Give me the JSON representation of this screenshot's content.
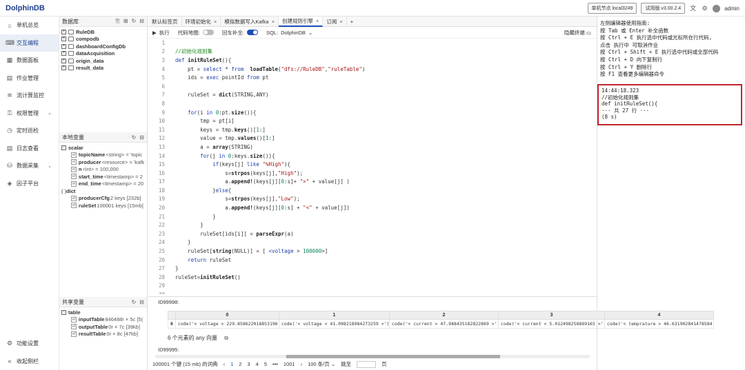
{
  "app": {
    "logo": "DolphinDB",
    "node_btn": "单机节点 local3249",
    "version_btn": "试用版 v3.00.2.4",
    "user": "admin"
  },
  "sidebar": {
    "items": [
      {
        "label": "单机总览",
        "icon": "home-icon"
      },
      {
        "label": "交互编程",
        "icon": "code-icon",
        "active": true
      },
      {
        "label": "数据面板",
        "icon": "dashboard-icon"
      },
      {
        "label": "作业管理",
        "icon": "job-icon"
      },
      {
        "label": "流计算监控",
        "icon": "stream-icon"
      },
      {
        "label": "权限管理",
        "icon": "lock-icon",
        "chevron": true
      },
      {
        "label": "定时巡检",
        "icon": "clock-icon"
      },
      {
        "label": "日志查看",
        "icon": "log-icon"
      },
      {
        "label": "数据采集",
        "icon": "collect-icon",
        "chevron": true
      },
      {
        "label": "因子平台",
        "icon": "factor-icon"
      }
    ],
    "settings": "功能设置",
    "collapse": "收起侧栏"
  },
  "db_panel": {
    "title": "数据库",
    "items": [
      "RuleDB",
      "compodb",
      "dashboardConfigDb",
      "dataAcquisition",
      "origin_data",
      "result_data"
    ]
  },
  "local_vars": {
    "title": "本地变量",
    "scalar_label": "scalar",
    "scalars": [
      {
        "name": "topicName",
        "meta": "<string> = 'topic"
      },
      {
        "name": "producer",
        "meta": "<resource> = 'kafk"
      },
      {
        "name": "n",
        "meta": "<int> = 100,000"
      },
      {
        "name": "start_time",
        "meta": "<timestamp> = 2"
      },
      {
        "name": "end_time",
        "meta": "<timestamp> = 20"
      }
    ],
    "dict_label": "dict",
    "dicts": [
      {
        "name": "producerCfg",
        "meta": "2 keys [232b]"
      },
      {
        "name": "ruleSet",
        "meta": "100001 keys [15mb]"
      }
    ]
  },
  "shared_vars": {
    "title": "共享变量",
    "table_label": "table",
    "tables": [
      {
        "name": "inputTable",
        "meta": "846488r × 5c [5("
      },
      {
        "name": "outputTable",
        "meta": "0r × 7c [39kb]"
      },
      {
        "name": "resultTable",
        "meta": "0r × 8c [47kb]"
      }
    ]
  },
  "tabs": [
    {
      "label": "默认标签页",
      "closable": false
    },
    {
      "label": "环境初始化",
      "closable": true
    },
    {
      "label": "模拟数据写入Kafka",
      "closable": true
    },
    {
      "label": "创建规则引擎",
      "closable": true,
      "active": true
    },
    {
      "label": "订阅",
      "closable": true
    }
  ],
  "toolbar": {
    "run": "执行",
    "code_map": "代码地图:",
    "autocomplete": "回车补全:",
    "sql_label": "SQL:",
    "sql_value": "DolphinDB",
    "hide_terminal": "隐藏终端"
  },
  "code_lines": [
    {
      "n": "1",
      "html": ""
    },
    {
      "n": "2",
      "html": "<span class='cm'>//初始化规则集</span>"
    },
    {
      "n": "3",
      "html": "<span class='kw'>def</span> <span class='fn'>initRuleSet</span>(){"
    },
    {
      "n": "4",
      "html": "    pt = <span class='kw'>select</span> * <span class='kw'>from</span>  <span class='fn'>loadTable</span>(<span class='st'>\"dfs://RuleDB\"</span>,<span class='st'>\"ruleTable\"</span>)"
    },
    {
      "n": "5",
      "html": "    ids = <span class='kw'>exec</span> pointId <span class='kw'>from</span> pt"
    },
    {
      "n": "6",
      "html": ""
    },
    {
      "n": "7",
      "html": "    ruleSet = <span class='fn'>dict</span>(STRING,ANY)"
    },
    {
      "n": "8",
      "html": ""
    },
    {
      "n": "9",
      "html": "    <span class='kw'>for</span>(i <span class='kw'>in</span> <span class='nm'>0</span>:pt.<span class='fn'>size</span>()){"
    },
    {
      "n": "10",
      "html": "        tmp = pt[i]"
    },
    {
      "n": "11",
      "html": "        keys = tmp.<span class='fn'>keys</span>()[<span class='nm'>1</span>:]"
    },
    {
      "n": "12",
      "html": "        value = tmp.<span class='fn'>values</span>()[<span class='nm'>1</span>:]"
    },
    {
      "n": "13",
      "html": "        a = <span class='fn'>array</span>(STRING)"
    },
    {
      "n": "14",
      "html": "        <span class='kw'>for</span>(j <span class='kw'>in</span> <span class='nm'>0</span>:keys.<span class='fn'>size</span>()){"
    },
    {
      "n": "15",
      "html": "            <span class='kw'>if</span>(keys[j] <span class='kw'>like</span> <span class='st'>\"%High\"</span>){"
    },
    {
      "n": "16",
      "html": "                s=<span class='fn'>strpos</span>(keys[j],<span class='st'>\"High\"</span>);"
    },
    {
      "n": "17",
      "html": "                a.<span class='fn'>append!</span>(keys[j][<span class='nm'>0</span>:s]+ <span class='st'>\">\"</span> + value[j] )"
    },
    {
      "n": "18",
      "html": "            }<span class='kw'>else</span>{"
    },
    {
      "n": "19",
      "html": "                s=<span class='fn'>strpos</span>(keys[j],<span class='st'>\"Low\"</span>);"
    },
    {
      "n": "20",
      "html": "                a.<span class='fn'>append!</span>(keys[j][<span class='nm'>0</span>:s] + <span class='st'>\"<\"</span> + value[j])"
    },
    {
      "n": "21",
      "html": "            }"
    },
    {
      "n": "22",
      "html": "        }"
    },
    {
      "n": "23",
      "html": "        ruleSet[ids[i]] = <span class='fn'>parseExpr</span>(a)"
    },
    {
      "n": "24",
      "html": "    }"
    },
    {
      "n": "25",
      "html": "    ruleSet[<span class='fn'>string</span>(NULL)] = [ <span class='kw'>&lt;voltage</span> &gt; <span class='nm'>100000</span>&gt;]"
    },
    {
      "n": "26",
      "html": "    <span class='kw'>return</span> ruleSet"
    },
    {
      "n": "27",
      "html": "}"
    },
    {
      "n": "28",
      "html": "ruleSet=<span class='fn'>initRuleSet</span>()"
    },
    {
      "n": "29",
      "html": ""
    },
    {
      "n": "30",
      "html": ""
    }
  ],
  "help_lines": [
    "左侧编辑器使用指南:",
    "按 Tab 或 Enter 补全函数",
    "按 Ctrl + E 执行选中代码或光标所在行代码,",
    "点击 执行中 可取消作业",
    "按 Ctrl + Shift + E 执行选中代码或全部代码",
    "按 Ctrl + D 向下复制行",
    "按 Ctrl + Y 删除行",
    "按 F1 查看更多编辑器命令"
  ],
  "log_lines": [
    "14:44:18.323",
    "//初始化规则集",
    "def initRuleSet(){",
    "··· 共 27 行 ···",
    "(8 s)"
  ],
  "result": {
    "id_top": "ID99998:",
    "columns": [
      "0",
      "1",
      "2",
      "3",
      "4"
    ],
    "row_index": "0",
    "cells": [
      "code('< voltage > 229.858622018853196 >')",
      "code('< voltage < 41.098218984273259 >')",
      "code('< current > 47.948435182822869 >')",
      "code('< current < 5.012498258869165 >')",
      "code('< temprature > 46.631902841478584 >')"
    ],
    "summary": "6 个元素的 any 向量",
    "id_bottom": "ID99995:"
  },
  "pager": {
    "summary": "100001 个键 (15 mb) 的词典",
    "pages": [
      "1",
      "2",
      "3",
      "4",
      "5",
      "•••",
      "1001"
    ],
    "per_page": "100 条/页",
    "goto": "跳至",
    "page_suffix": "页"
  }
}
